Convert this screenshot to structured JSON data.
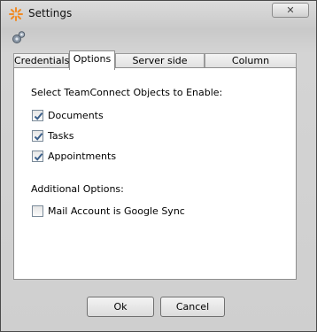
{
  "window": {
    "title": "Settings",
    "close_label": "✕"
  },
  "tabs": [
    {
      "label": "Credentials",
      "active": false
    },
    {
      "label": "Options",
      "active": true
    },
    {
      "label": "Server side settings",
      "active": false
    },
    {
      "label": "Column Preferences",
      "active": false
    }
  ],
  "options": {
    "objects_heading": "Select TeamConnect Objects to Enable:",
    "objects": [
      {
        "label": "Documents",
        "checked": true
      },
      {
        "label": "Tasks",
        "checked": true
      },
      {
        "label": "Appointments",
        "checked": true
      }
    ],
    "additional_heading": "Additional Options:",
    "additional": [
      {
        "label": "Mail Account is Google Sync",
        "checked": false
      }
    ]
  },
  "buttons": {
    "ok": "Ok",
    "cancel": "Cancel"
  },
  "icons": {
    "title": "settings-sparkle-icon",
    "toolbar": "gear-icon",
    "check": "checkmark-icon"
  },
  "colors": {
    "check_mark": "#3b5f8a",
    "title_icon": "#f08a24"
  }
}
